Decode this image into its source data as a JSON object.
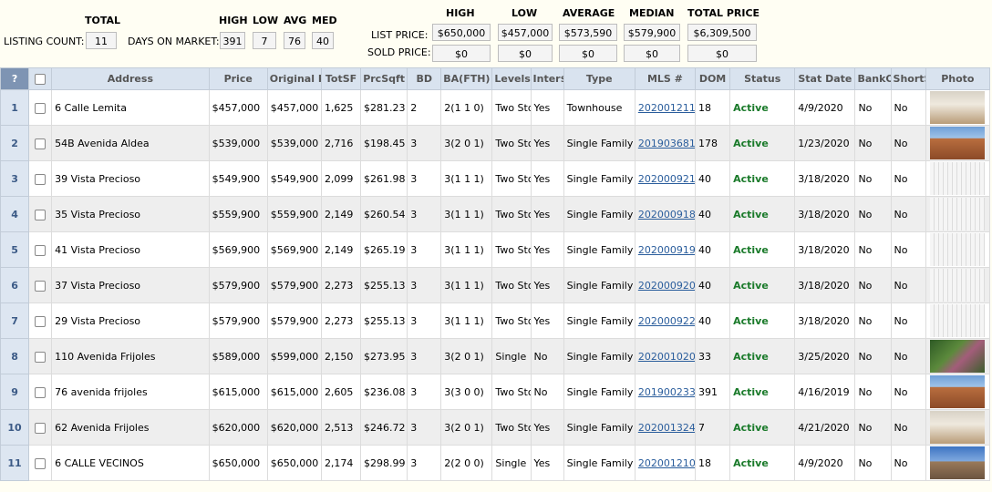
{
  "summary": {
    "total_header": "TOTAL",
    "listing_count_label": "LISTING COUNT:",
    "listing_count": "11",
    "dom_label": "DAYS ON MARKET:",
    "dom_headers": {
      "high": "HIGH",
      "low": "LOW",
      "avg": "AVG",
      "med": "MED"
    },
    "dom_values": {
      "high": "391",
      "low": "7",
      "avg": "76",
      "med": "40"
    },
    "price_headers": {
      "high": "HIGH",
      "low": "LOW",
      "average": "AVERAGE",
      "median": "MEDIAN",
      "total": "TOTAL PRICE"
    },
    "list_price_label": "LIST PRICE:",
    "sold_price_label": "SOLD PRICE:",
    "list_price": {
      "high": "$650,000",
      "low": "$457,000",
      "average": "$573,590",
      "median": "$579,900",
      "total": "$6,309,500"
    },
    "sold_price": {
      "high": "$0",
      "low": "$0",
      "average": "$0",
      "median": "$0",
      "total": "$0"
    }
  },
  "table": {
    "headers": [
      "?",
      "",
      "Address",
      "Price",
      "Original P",
      "TotSF",
      "PrcSqft",
      "BD",
      "BA(FTH)",
      "Levels",
      "Inter$",
      "Type",
      "MLS #",
      "DOM",
      "Status",
      "Stat Date",
      "BankO",
      "ShortS",
      "Photo"
    ],
    "rows": [
      {
        "n": "1",
        "address": "6 Calle Lemita",
        "price": "$457,000",
        "orig": "$457,000",
        "sf": "1,625",
        "psf": "$281.23",
        "bd": "2",
        "ba": "2(1 1 0)",
        "levels": "Two Sto",
        "inter": "Yes",
        "type": "Townhouse",
        "mls": "202001211",
        "dom": "18",
        "status": "Active",
        "date": "4/9/2020",
        "bank": "No",
        "short": "No",
        "photo": "interior-photo"
      },
      {
        "n": "2",
        "address": "54B Avenida Aldea",
        "price": "$539,000",
        "orig": "$539,000",
        "sf": "2,716",
        "psf": "$198.45",
        "bd": "3",
        "ba": "3(2 0 1)",
        "levels": "Two Sto",
        "inter": "Yes",
        "type": "Single Family",
        "mls": "201903681",
        "dom": "178",
        "status": "Active",
        "date": "1/23/2020",
        "bank": "No",
        "short": "No",
        "photo": "adobe-exterior-photo"
      },
      {
        "n": "3",
        "address": "39 Vista Precioso",
        "price": "$549,900",
        "orig": "$549,900",
        "sf": "2,099",
        "psf": "$261.98",
        "bd": "3",
        "ba": "3(1 1 1)",
        "levels": "Two Sto",
        "inter": "Yes",
        "type": "Single Family",
        "mls": "202000921",
        "dom": "40",
        "status": "Active",
        "date": "3/18/2020",
        "bank": "No",
        "short": "No",
        "photo": "sketch-photo"
      },
      {
        "n": "4",
        "address": "35 Vista Precioso",
        "price": "$559,900",
        "orig": "$559,900",
        "sf": "2,149",
        "psf": "$260.54",
        "bd": "3",
        "ba": "3(1 1 1)",
        "levels": "Two Sto",
        "inter": "Yes",
        "type": "Single Family",
        "mls": "202000918",
        "dom": "40",
        "status": "Active",
        "date": "3/18/2020",
        "bank": "No",
        "short": "No",
        "photo": "sketch-photo"
      },
      {
        "n": "5",
        "address": "41 Vista Precioso",
        "price": "$569,900",
        "orig": "$569,900",
        "sf": "2,149",
        "psf": "$265.19",
        "bd": "3",
        "ba": "3(1 1 1)",
        "levels": "Two Sto",
        "inter": "Yes",
        "type": "Single Family",
        "mls": "202000919",
        "dom": "40",
        "status": "Active",
        "date": "3/18/2020",
        "bank": "No",
        "short": "No",
        "photo": "sketch-photo"
      },
      {
        "n": "6",
        "address": "37 Vista Precioso",
        "price": "$579,900",
        "orig": "$579,900",
        "sf": "2,273",
        "psf": "$255.13",
        "bd": "3",
        "ba": "3(1 1 1)",
        "levels": "Two Sto",
        "inter": "Yes",
        "type": "Single Family",
        "mls": "202000920",
        "dom": "40",
        "status": "Active",
        "date": "3/18/2020",
        "bank": "No",
        "short": "No",
        "photo": "sketch-photo"
      },
      {
        "n": "7",
        "address": "29 Vista Precioso",
        "price": "$579,900",
        "orig": "$579,900",
        "sf": "2,273",
        "psf": "$255.13",
        "bd": "3",
        "ba": "3(1 1 1)",
        "levels": "Two Sto",
        "inter": "Yes",
        "type": "Single Family",
        "mls": "202000922",
        "dom": "40",
        "status": "Active",
        "date": "3/18/2020",
        "bank": "No",
        "short": "No",
        "photo": "sketch-photo"
      },
      {
        "n": "8",
        "address": "110 Avenida Frijoles",
        "price": "$589,000",
        "orig": "$599,000",
        "sf": "2,150",
        "psf": "$273.95",
        "bd": "3",
        "ba": "3(2 0 1)",
        "levels": "Single",
        "inter": "No",
        "type": "Single Family",
        "mls": "202001020",
        "dom": "33",
        "status": "Active",
        "date": "3/25/2020",
        "bank": "No",
        "short": "No",
        "photo": "garden-photo"
      },
      {
        "n": "9",
        "address": "76 avenida frijoles",
        "price": "$615,000",
        "orig": "$615,000",
        "sf": "2,605",
        "psf": "$236.08",
        "bd": "3",
        "ba": "3(3 0 0)",
        "levels": "Two Sto",
        "inter": "No",
        "type": "Single Family",
        "mls": "201900233",
        "dom": "391",
        "status": "Active",
        "date": "4/16/2019",
        "bank": "No",
        "short": "No",
        "photo": "adobe-exterior-photo"
      },
      {
        "n": "10",
        "address": "62 Avenida Frijoles",
        "price": "$620,000",
        "orig": "$620,000",
        "sf": "2,513",
        "psf": "$246.72",
        "bd": "3",
        "ba": "3(2 0 1)",
        "levels": "Two Sto",
        "inter": "Yes",
        "type": "Single Family",
        "mls": "202001324",
        "dom": "7",
        "status": "Active",
        "date": "4/21/2020",
        "bank": "No",
        "short": "No",
        "photo": "interior-photo"
      },
      {
        "n": "11",
        "address": "6 CALLE VECINOS",
        "price": "$650,000",
        "orig": "$650,000",
        "sf": "2,174",
        "psf": "$298.99",
        "bd": "3",
        "ba": "2(2 0 0)",
        "levels": "Single",
        "inter": "Yes",
        "type": "Single Family",
        "mls": "202001210",
        "dom": "18",
        "status": "Active",
        "date": "4/9/2020",
        "bank": "No",
        "short": "No",
        "photo": "sky-exterior-photo"
      }
    ]
  },
  "colors": {
    "status_active": "#1a7a2a",
    "link": "#2a5d9c",
    "header_bg": "#d9e3ef",
    "row_alt": "#eeeeee"
  }
}
